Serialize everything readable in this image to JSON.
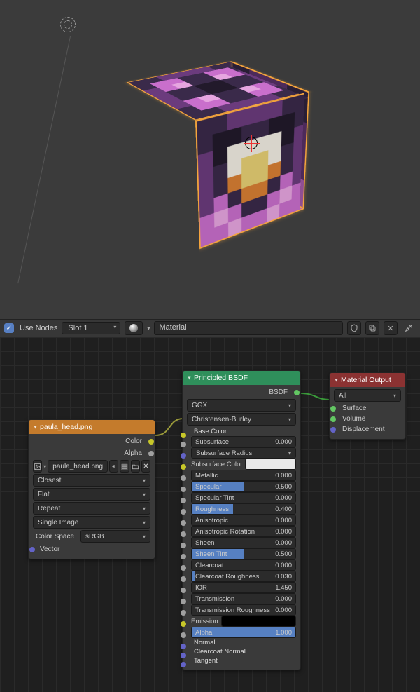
{
  "mat_bar": {
    "use_nodes": "Use Nodes",
    "slot": "Slot 1",
    "material_name": "Material"
  },
  "tex_node": {
    "title": "paula_head.png",
    "out_color": "Color",
    "out_alpha": "Alpha",
    "file": "paula_head.png",
    "interp": "Closest",
    "proj": "Flat",
    "ext": "Repeat",
    "source": "Single Image",
    "cs_label": "Color Space",
    "cs_value": "sRGB",
    "in_vector": "Vector"
  },
  "bsdf": {
    "title": "Principled BSDF",
    "out": "BSDF",
    "dist": "GGX",
    "sss_method": "Christensen-Burley",
    "rows": [
      {
        "kind": "label",
        "name": "Base Color",
        "sock": "color"
      },
      {
        "kind": "slider",
        "name": "Subsurface",
        "val": "0.000",
        "fill": 0,
        "sock": "float"
      },
      {
        "kind": "label-caret",
        "name": "Subsurface Radius",
        "sock": "vec"
      },
      {
        "kind": "colorwell",
        "name": "Subsurface Color",
        "color": "#e8e8e8",
        "sock": "color"
      },
      {
        "kind": "slider",
        "name": "Metallic",
        "val": "0.000",
        "fill": 0,
        "sock": "float"
      },
      {
        "kind": "slider",
        "name": "Specular",
        "val": "0.500",
        "fill": 0.5,
        "sock": "float"
      },
      {
        "kind": "slider",
        "name": "Specular Tint",
        "val": "0.000",
        "fill": 0,
        "sock": "float"
      },
      {
        "kind": "slider",
        "name": "Roughness",
        "val": "0.400",
        "fill": 0.4,
        "sock": "float"
      },
      {
        "kind": "slider",
        "name": "Anisotropic",
        "val": "0.000",
        "fill": 0,
        "sock": "float"
      },
      {
        "kind": "slider",
        "name": "Anisotropic Rotation",
        "val": "0.000",
        "fill": 0,
        "sock": "float"
      },
      {
        "kind": "slider",
        "name": "Sheen",
        "val": "0.000",
        "fill": 0,
        "sock": "float"
      },
      {
        "kind": "slider",
        "name": "Sheen Tint",
        "val": "0.500",
        "fill": 0.5,
        "sock": "float"
      },
      {
        "kind": "slider",
        "name": "Clearcoat",
        "val": "0.000",
        "fill": 0,
        "sock": "float"
      },
      {
        "kind": "slider",
        "name": "Clearcoat Roughness",
        "val": "0.030",
        "fill": 0.03,
        "sock": "float"
      },
      {
        "kind": "slider",
        "name": "IOR",
        "val": "1.450",
        "fill": 0.0,
        "sock": "float"
      },
      {
        "kind": "slider",
        "name": "Transmission",
        "val": "0.000",
        "fill": 0,
        "sock": "float"
      },
      {
        "kind": "slider",
        "name": "Transmission Roughness",
        "val": "0.000",
        "fill": 0,
        "sock": "float"
      },
      {
        "kind": "colorwell",
        "name": "Emission",
        "color": "#000000",
        "sock": "color"
      },
      {
        "kind": "slider",
        "name": "Alpha",
        "val": "1.000",
        "fill": 1.0,
        "sock": "float"
      },
      {
        "kind": "label",
        "name": "Normal",
        "sock": "vec"
      },
      {
        "kind": "label",
        "name": "Clearcoat Normal",
        "sock": "vec"
      },
      {
        "kind": "label",
        "name": "Tangent",
        "sock": "vec"
      }
    ]
  },
  "out_node": {
    "title": "Material Output",
    "target": "All",
    "ins": [
      {
        "name": "Surface",
        "sock": "shader"
      },
      {
        "name": "Volume",
        "sock": "shader"
      },
      {
        "name": "Displacement",
        "sock": "vec"
      }
    ]
  },
  "cube_palette": {
    "dp": "#3a2a4a",
    "mp": "#6b3b7d",
    "p": "#c96fcc",
    "lp": "#e6a5e0",
    "w": "#f1ece2",
    "y": "#e7cf74",
    "o": "#d87f34",
    "dk": "#221a2b"
  },
  "cube_faces": {
    "top": [
      "dp",
      "dp",
      "mp",
      "mp",
      "mp",
      "mp",
      "dp",
      "dp",
      "dp",
      "p",
      "p",
      "dp",
      "dp",
      "p",
      "p",
      "dp",
      "mp",
      "p",
      "lp",
      "dp",
      "dp",
      "lp",
      "p",
      "mp",
      "mp",
      "dp",
      "dp",
      "dk",
      "dk",
      "dp",
      "dp",
      "mp",
      "mp",
      "dp",
      "dp",
      "dk",
      "dk",
      "dp",
      "dp",
      "mp",
      "mp",
      "p",
      "lp",
      "dp",
      "dp",
      "lp",
      "p",
      "mp",
      "dp",
      "p",
      "p",
      "dp",
      "dp",
      "p",
      "p",
      "dp",
      "dp",
      "dp",
      "mp",
      "mp",
      "mp",
      "mp",
      "dp",
      "dp"
    ],
    "front": [
      "dp",
      "dp",
      "mp",
      "mp",
      "mp",
      "mp",
      "dp",
      "dp",
      "dp",
      "dk",
      "dk",
      "dp",
      "dp",
      "dk",
      "dk",
      "dp",
      "mp",
      "dk",
      "w",
      "w",
      "w",
      "w",
      "dk",
      "mp",
      "mp",
      "dp",
      "w",
      "y",
      "y",
      "w",
      "dp",
      "mp",
      "mp",
      "dp",
      "o",
      "y",
      "y",
      "o",
      "dp",
      "mp",
      "mp",
      "p",
      "dp",
      "o",
      "o",
      "dp",
      "p",
      "mp",
      "p",
      "lp",
      "p",
      "dp",
      "dp",
      "p",
      "lp",
      "p",
      "p",
      "p",
      "lp",
      "p",
      "p",
      "lp",
      "p",
      "p"
    ],
    "right": [
      "dp",
      "dp",
      "mp",
      "mp",
      "mp",
      "mp",
      "dp",
      "dp",
      "dp",
      "dk",
      "dk",
      "dp",
      "dp",
      "dk",
      "dk",
      "dp",
      "mp",
      "dk",
      "w",
      "w",
      "w",
      "w",
      "dk",
      "mp",
      "mp",
      "dp",
      "w",
      "y",
      "y",
      "w",
      "dp",
      "mp",
      "mp",
      "dp",
      "o",
      "y",
      "y",
      "o",
      "dp",
      "mp",
      "mp",
      "p",
      "dp",
      "o",
      "o",
      "dp",
      "p",
      "mp",
      "p",
      "lp",
      "p",
      "dp",
      "dp",
      "p",
      "lp",
      "p",
      "p",
      "p",
      "lp",
      "p",
      "p",
      "lp",
      "p",
      "p"
    ]
  }
}
